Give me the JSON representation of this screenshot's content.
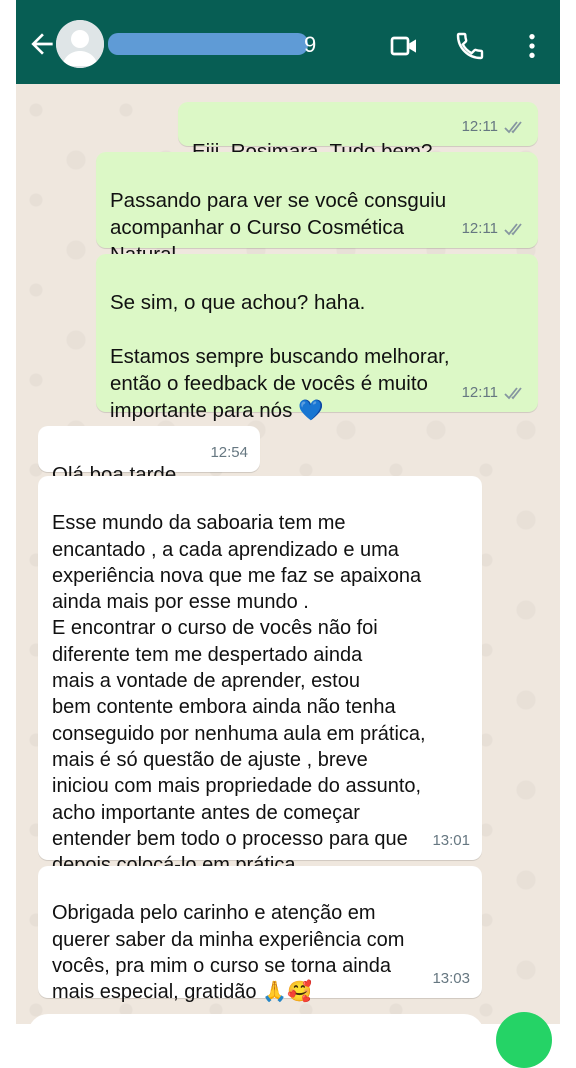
{
  "header": {
    "contact_name_visible": "9",
    "icons": [
      "back-arrow-icon",
      "avatar-icon",
      "video-call-icon",
      "phone-call-icon",
      "more-vert-icon"
    ]
  },
  "colors": {
    "header": "#075e54",
    "outgoing_bubble": "#dcf8c6",
    "incoming_bubble": "#ffffff",
    "chat_bg": "#efe7de",
    "name_redaction": "#5f9bd6",
    "fab": "#25d366"
  },
  "messages": [
    {
      "direction": "out",
      "text": "Eiii, Rosimara. Tudo bem?",
      "time": "12:11",
      "status": "read-ticks-icon"
    },
    {
      "direction": "out",
      "text": "Passando para ver se você consguiu\nacompanhar o Curso Cosmética\nNatural...",
      "time": "12:11",
      "status": "read-ticks-icon"
    },
    {
      "direction": "out",
      "text": "Se sim, o que achou? haha.\n\nEstamos sempre buscando melhorar,\nentão o feedback de vocês é muito\nimportante para nós 💙",
      "time": "12:11",
      "status": "read-ticks-icon"
    },
    {
      "direction": "in",
      "text": "Olá boa tarde",
      "time": "12:54"
    },
    {
      "direction": "in",
      "text": "Esse mundo da saboaria tem me\nencantado ,  a cada  aprendizado e uma\nexperiência nova que me faz se apaixona\nainda mais por esse mundo .\nE encontrar o curso de vocês não foi\ndiferente tem me despertado ainda\nmais a vontade de aprender, estou\nbem contente embora ainda não tenha\nconseguido por nenhuma aula em prática,\nmais é só questão de ajuste , breve\niniciou com mais propriedade do assunto,\nacho importante antes de começar\nentender bem todo o processo para que\ndepois colocá-lo em prática",
      "time": "13:01"
    },
    {
      "direction": "in",
      "text": "Obrigada pelo carinho e atenção em\nquerer saber da minha experiência com\nvocês, pra mim o curso se torna ainda\nmais especial, gratidão 🙏🥰",
      "time": "13:03"
    }
  ]
}
